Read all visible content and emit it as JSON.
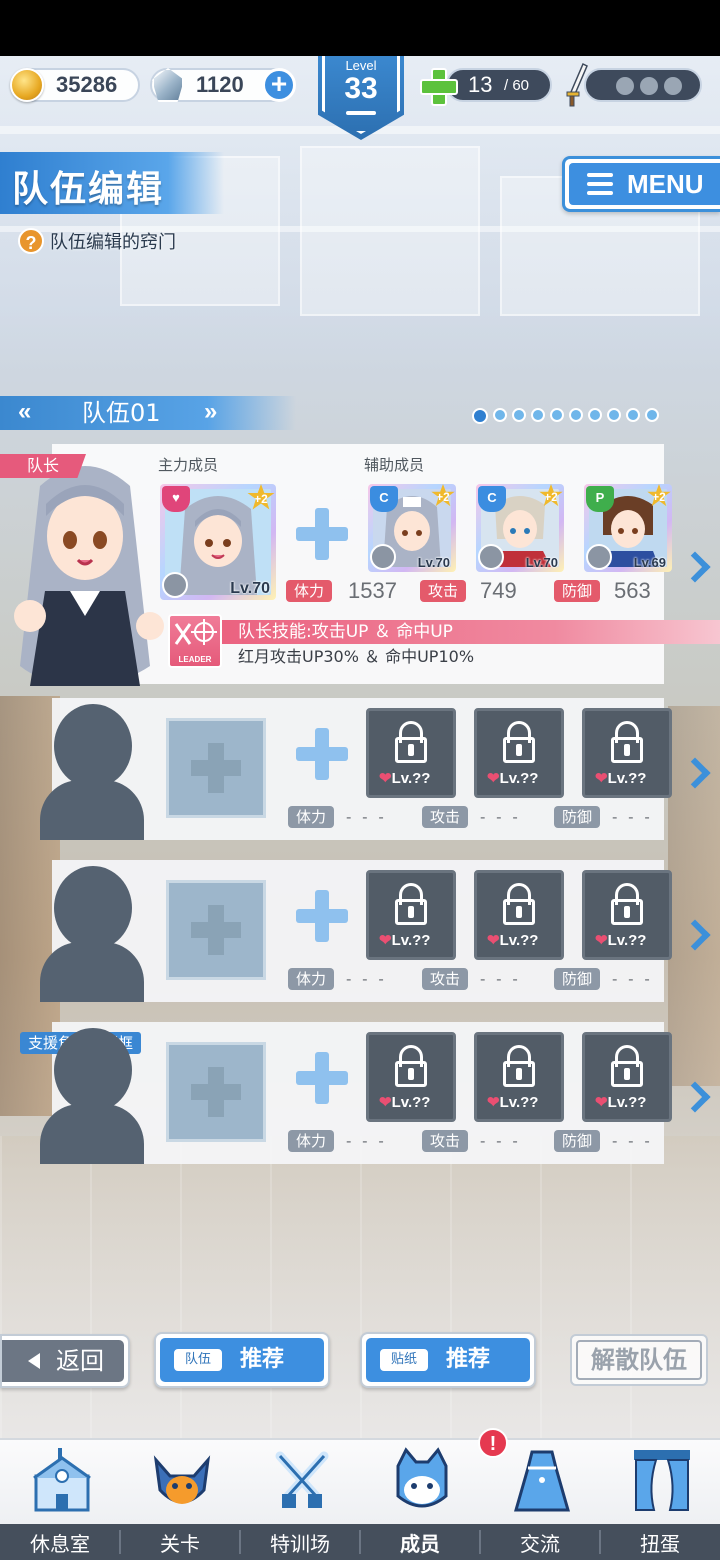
{
  "status": {
    "coins": "35286",
    "gems": "1120",
    "level_label": "Level",
    "level": "33",
    "stamina": "13",
    "stamina_max": "/ 60"
  },
  "header": {
    "title": "队伍编辑",
    "help_text": "队伍编辑的窍门",
    "menu_label": "MENU"
  },
  "party": {
    "prev": "«",
    "name": "队伍01",
    "next": "»",
    "page_count": 10,
    "current_page": 1
  },
  "team1": {
    "leader_tag": "队长",
    "main_label": "主力成员",
    "support_label": "辅助成员",
    "main_card": {
      "plus": "+2",
      "level": "Lv.70",
      "type_icon": "cute-type-icon"
    },
    "support_cards": [
      {
        "plus": "+2",
        "level": "Lv.70",
        "type_icon": "cool-type-icon"
      },
      {
        "plus": "+2",
        "level": "Lv.70",
        "type_icon": "cool-type-icon"
      },
      {
        "plus": "+2",
        "level": "Lv.69",
        "type_icon": "passion-type-icon"
      }
    ],
    "stats": {
      "hp_label": "体力",
      "hp": "1537",
      "atk_label": "攻击",
      "atk": "749",
      "def_label": "防御",
      "def": "563"
    },
    "leader_skill_badge": "LEADER",
    "leader_skill_title": "队长技能:攻击UP ＆ 命中UP",
    "leader_skill_desc": "红月攻击UP30% ＆ 命中UP10%"
  },
  "empty_teams": [
    {
      "locked_level": "Lv.??",
      "hp_label": "体力",
      "atk_label": "攻击",
      "def_label": "防御",
      "placeholder": "- - -"
    },
    {
      "locked_level": "Lv.??",
      "hp_label": "体力",
      "atk_label": "攻击",
      "def_label": "防御",
      "placeholder": "- - -"
    },
    {
      "locked_level": "Lv.??",
      "hp_label": "体力",
      "atk_label": "攻击",
      "def_label": "防御",
      "placeholder": "- - -"
    }
  ],
  "support_change_label": "支援角色变更框",
  "buttons": {
    "back": "返回",
    "team_tag": "队伍",
    "team_recommend": "推荐",
    "sticker_tag": "贴纸",
    "sticker_recommend": "推荐",
    "disband": "解散队伍"
  },
  "tabs": [
    {
      "label": "休息室",
      "icon": "school-building-icon"
    },
    {
      "label": "关卡",
      "icon": "demon-mask-icon"
    },
    {
      "label": "特训场",
      "icon": "crossed-swords-icon"
    },
    {
      "label": "成员",
      "icon": "mascot-face-icon"
    },
    {
      "label": "交流",
      "icon": "dress-icon"
    },
    {
      "label": "扭蛋",
      "icon": "curtain-stage-icon"
    }
  ],
  "notification_badge": "!",
  "active_tab": "成员",
  "colors": {
    "accent": "#3d8fe0",
    "leader": "#e65a7c",
    "stat_red": "#e45a6b"
  }
}
